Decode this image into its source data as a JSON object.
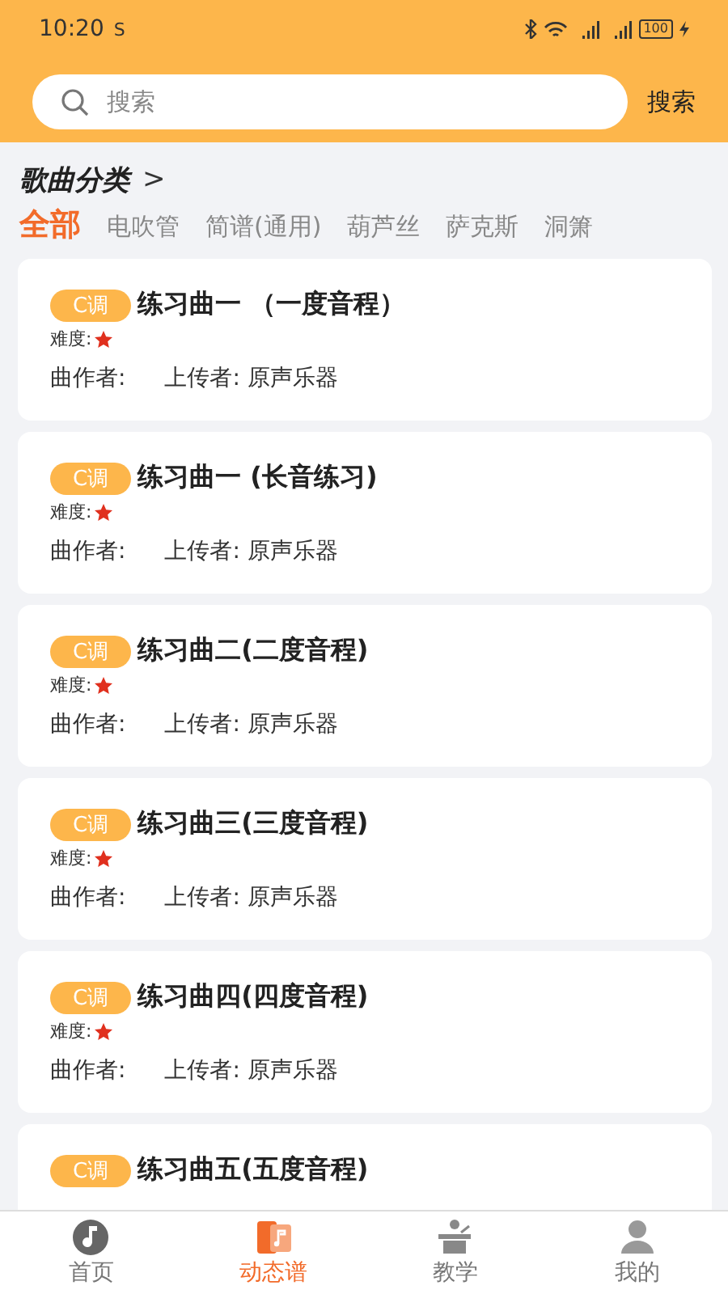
{
  "status_bar": {
    "time": "10:20",
    "carrier_mark": "S",
    "battery": "100"
  },
  "search": {
    "placeholder": "搜索",
    "button": "搜索"
  },
  "category": {
    "title": "歌曲分类",
    "arrow": ">"
  },
  "tabs": [
    {
      "label": "全部",
      "selected": true
    },
    {
      "label": "电吹管",
      "selected": false
    },
    {
      "label": "简谱(通用)",
      "selected": false
    },
    {
      "label": "葫芦丝",
      "selected": false
    },
    {
      "label": "萨克斯",
      "selected": false
    },
    {
      "label": "洞箫",
      "selected": false
    }
  ],
  "songs": [
    {
      "key": "C调",
      "title": "练习曲一 （一度音程）",
      "difficulty_label": "难度:",
      "composer": "曲作者:",
      "uploader": "上传者: 原声乐器"
    },
    {
      "key": "C调",
      "title": "练习曲一 (长音练习)",
      "difficulty_label": "难度:",
      "composer": "曲作者:",
      "uploader": "上传者: 原声乐器"
    },
    {
      "key": "C调",
      "title": "练习曲二(二度音程)",
      "difficulty_label": "难度:",
      "composer": "曲作者:",
      "uploader": "上传者: 原声乐器"
    },
    {
      "key": "C调",
      "title": "练习曲三(三度音程)",
      "difficulty_label": "难度:",
      "composer": "曲作者:",
      "uploader": "上传者: 原声乐器"
    },
    {
      "key": "C调",
      "title": "练习曲四(四度音程)",
      "difficulty_label": "难度:",
      "composer": "曲作者:",
      "uploader": "上传者: 原声乐器"
    },
    {
      "key": "C调",
      "title": "练习曲五(五度音程)"
    }
  ],
  "nav": [
    {
      "label": "首页",
      "selected": false
    },
    {
      "label": "动态谱",
      "selected": true
    },
    {
      "label": "教学",
      "selected": false
    },
    {
      "label": "我的",
      "selected": false
    }
  ]
}
